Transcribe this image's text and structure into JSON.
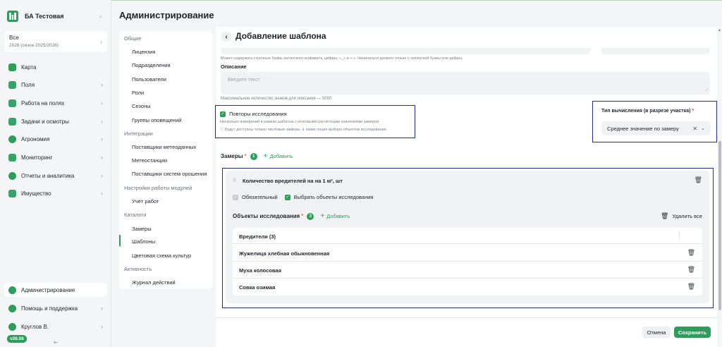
{
  "sidebar": {
    "org_name": "БА Тестовая",
    "season": {
      "title": "Все",
      "subtitle": "2026 (сезон 2025/2026)"
    },
    "nav": [
      {
        "label": "Карта",
        "icon": "map-icon",
        "color": "#2e9c5a",
        "chevron": false
      },
      {
        "label": "Поля",
        "icon": "fields-icon",
        "color": "#2e9c5a",
        "chevron": true
      },
      {
        "label": "Работа на полях",
        "icon": "tractor-icon",
        "color": "#2e9c5a",
        "chevron": true
      },
      {
        "label": "Задачи и осмотры",
        "icon": "tasks-icon",
        "color": "#2e9c5a",
        "chevron": true
      },
      {
        "label": "Агрономия",
        "icon": "leaf-icon",
        "color": "#2e9c5a",
        "chevron": true
      },
      {
        "label": "Мониторинг",
        "icon": "monitoring-icon",
        "color": "#2e9c5a",
        "chevron": true
      },
      {
        "label": "Отчеты и аналитика",
        "icon": "pie-chart-icon",
        "color": "#2e9c5a",
        "chevron": true
      },
      {
        "label": "Имущество",
        "icon": "property-icon",
        "color": "#2e9c5a",
        "chevron": true
      }
    ],
    "bottom_nav": [
      {
        "label": "Администрирование",
        "icon": "gear-icon",
        "active": true
      },
      {
        "label": "Помощь и поддержка",
        "icon": "help-icon",
        "active": false
      },
      {
        "label": "Круглов В.",
        "icon": "user-icon",
        "active": false
      }
    ],
    "version": "v26.06"
  },
  "page_title": "Администрирование",
  "subnav": {
    "groups": [
      {
        "label": "Общие",
        "items": [
          "Лицензия",
          "Подразделения",
          "Пользователи",
          "Роли",
          "Сезоны",
          "Группы оповещений"
        ]
      },
      {
        "label": "Интеграции",
        "items": [
          "Поставщики метеоданных",
          "Метеостанции",
          "Поставщики систем орошения"
        ]
      },
      {
        "label": "Настройки работы модулей",
        "items": [
          "Учёт работ"
        ]
      },
      {
        "label": "Каталоги",
        "items": [
          "Замеры",
          "Шаблоны",
          "Цветовая схема культур"
        ]
      },
      {
        "label": "Активность",
        "items": [
          "Журнал действий"
        ]
      }
    ],
    "active_item": "Шаблоны"
  },
  "form": {
    "title": "Добавление шаблона",
    "code_hint": "Может содержать строчные буквы латинского алфавита, цифры, «_» и «-». Начинаться должен только с латинской буквы или цифры.",
    "description_label": "Описание",
    "description_placeholder": "Введите текст",
    "description_hint": "Максимальное количество знаков для описания — 5000",
    "repeats": {
      "label": "Повторы исследования",
      "checked": true,
      "sub": "Несколько измерений в рамках шаблона с итоговыми расчётными значениями замеров",
      "info": "ⓘ Будут доступны только числовые замеры, а также опция выбора объектов исследования."
    },
    "calc_type": {
      "label": "Тип вычисления (в разрезе участка)",
      "required_mark": "*",
      "value": "Среднее значение по замеру"
    },
    "measurements": {
      "title": "Замеры",
      "required_mark": "*",
      "count": "1",
      "add_label": "Добавить",
      "items": [
        {
          "name": "Количество вредителей на на 1 м², шт",
          "required_label": "Обязательный",
          "required_checked": true,
          "select_objects_label": "Выбрать объекты исследования",
          "select_objects_checked": true,
          "objects": {
            "title": "Объекты исследования",
            "required_mark": "*",
            "count": "3",
            "add_label": "Добавить",
            "delete_all_label": "Удалить все",
            "group_header": "Вредители (3)",
            "rows": [
              "Жужелица хлебная обыкновенная",
              "Муха колосовая",
              "Совка озимая"
            ]
          }
        }
      ]
    },
    "cancel_label": "Отмена",
    "save_label": "Сохранить"
  },
  "colors": {
    "accent": "#2e9c5a",
    "highlight_border": "#1f2f85",
    "required": "#d93025"
  }
}
